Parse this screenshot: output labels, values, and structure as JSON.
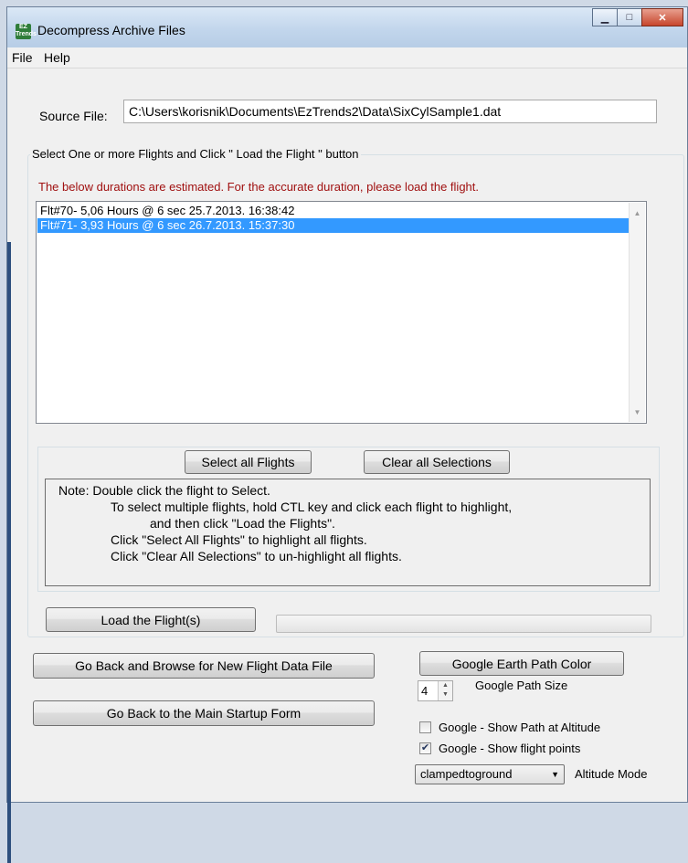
{
  "window": {
    "title": "Decompress Archive Files",
    "icon_text": "EZ Trends",
    "controls": [
      "minimize",
      "maximize",
      "close"
    ]
  },
  "menu": {
    "items": [
      "File",
      "Help"
    ]
  },
  "source": {
    "label": "Source File:",
    "value": "C:\\Users\\korisnik\\Documents\\EzTrends2\\Data\\SixCylSample1.dat"
  },
  "flights_group": {
    "legend": "Select One or more Flights and Click \" Load the Flight \" button",
    "warning": "The below durations are estimated. For the accurate duration, please load the flight.",
    "list": [
      {
        "text": "Flt#70- 5,06 Hours @ 6 sec 25.7.2013. 16:38:42",
        "selected": false
      },
      {
        "text": "Flt#71- 3,93 Hours @ 6 sec 26.7.2013. 15:37:30",
        "selected": true
      }
    ],
    "select_all_label": "Select all Flights",
    "clear_all_label": "Clear all Selections",
    "note": {
      "line1": "Note:  Double click the flight to Select.",
      "line2": "To select multiple flights, hold CTL key and click each flight to highlight,",
      "line3": "and then click \"Load the Flights\".",
      "line4": "Click \"Select All Flights\" to highlight all flights.",
      "line5": "Click \"Clear All Selections\" to un-highlight all flights."
    },
    "load_label": "Load the Flight(s)",
    "load_progress": 0
  },
  "browse_label": "Go Back and Browse for New Flight Data File",
  "main_form_label": "Go Back to the Main Startup Form",
  "google": {
    "path_color_label": "Google Earth Path Color",
    "path_size_label": "Google Path Size",
    "path_size_value": "4",
    "show_path_altitude_label": "Google - Show Path at Altitude",
    "show_path_altitude_checked": false,
    "show_points_label": "Google - Show flight points",
    "show_points_checked": true,
    "altitude_mode_value": "clampedtoground",
    "altitude_mode_label": "Altitude Mode"
  }
}
